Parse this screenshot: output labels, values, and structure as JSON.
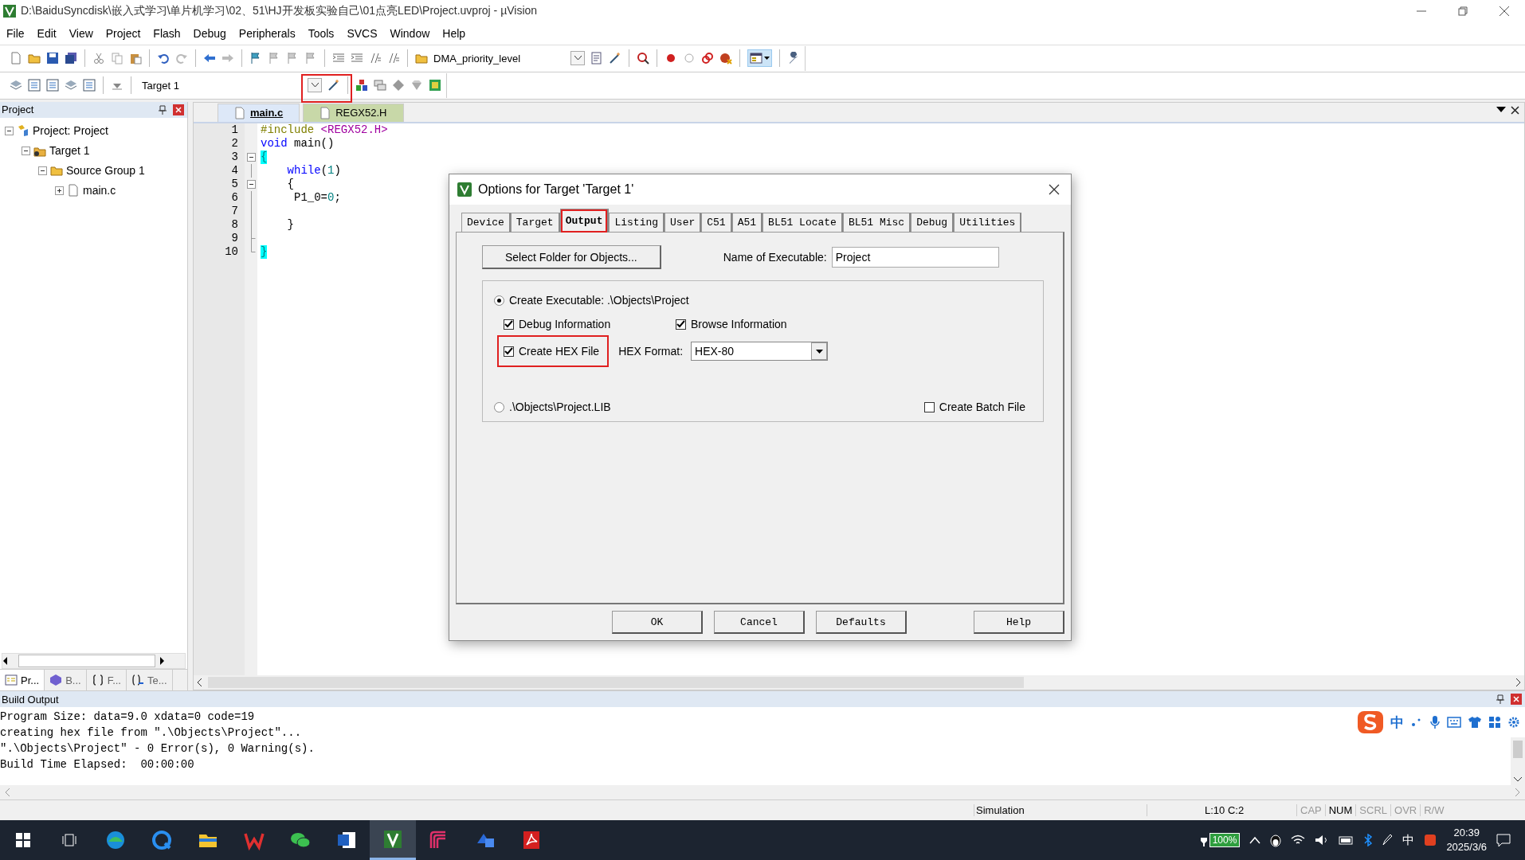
{
  "window": {
    "title": "D:\\BaiduSyncdisk\\嵌入式学习\\单片机学习\\02、51\\HJ开发板实验自己\\01点亮LED\\Project.uvproj - µVision"
  },
  "menu": [
    "File",
    "Edit",
    "View",
    "Project",
    "Flash",
    "Debug",
    "Peripherals",
    "Tools",
    "SVCS",
    "Window",
    "Help"
  ],
  "toolbar": {
    "function_combo": "DMA_priority_level",
    "target_combo": "Target 1",
    "options_button_highlighted": true
  },
  "project_panel": {
    "title": "Project",
    "tree": [
      {
        "label": "Project: Project",
        "kind": "project",
        "expanded": true,
        "children": [
          {
            "label": "Target 1",
            "kind": "target",
            "expanded": true,
            "children": [
              {
                "label": "Source Group 1",
                "kind": "group",
                "expanded": true,
                "children": [
                  {
                    "label": "main.c",
                    "kind": "file",
                    "expanded": false
                  }
                ]
              }
            ]
          }
        ]
      }
    ],
    "tabs": [
      {
        "label": "Pr...",
        "selected": true
      },
      {
        "label": "B...",
        "selected": false
      },
      {
        "label": "F...",
        "selected": false
      },
      {
        "label": "Te...",
        "selected": false
      }
    ]
  },
  "editor": {
    "tabs": [
      {
        "label": "main.c",
        "selected": true
      },
      {
        "label": "REGX52.H",
        "selected": false
      }
    ],
    "lines": [
      {
        "number": "1",
        "fold_box": false,
        "tokens": [
          {
            "kind": "directive",
            "text": "#include"
          },
          {
            "kind": "header",
            "text": " <REGX52.H>"
          }
        ]
      },
      {
        "number": "2",
        "fold_box": false,
        "tokens": [
          {
            "kind": "keyword",
            "text": "void"
          },
          {
            "kind": "plain",
            "text": " main()"
          }
        ]
      },
      {
        "number": "3",
        "fold_box": true,
        "tokens": [
          {
            "kind": "brace-match",
            "text": "{"
          }
        ]
      },
      {
        "number": "4",
        "fold_box": false,
        "tokens": [
          {
            "kind": "keyword",
            "text": "    while"
          },
          {
            "kind": "plain",
            "text": "("
          },
          {
            "kind": "number",
            "text": "1"
          },
          {
            "kind": "plain",
            "text": ")"
          }
        ]
      },
      {
        "number": "5",
        "fold_box": true,
        "tokens": [
          {
            "kind": "plain",
            "text": "    {"
          }
        ]
      },
      {
        "number": "6",
        "fold_box": false,
        "tokens": [
          {
            "kind": "plain",
            "text": "     P1_0="
          },
          {
            "kind": "number",
            "text": "0"
          },
          {
            "kind": "plain",
            "text": ";"
          }
        ]
      },
      {
        "number": "7",
        "fold_box": false
      },
      {
        "number": "8",
        "fold_box": false,
        "tokens": [
          {
            "kind": "plain",
            "text": "    }"
          }
        ]
      },
      {
        "number": "9",
        "fold_box": false
      },
      {
        "number": "10",
        "fold_box": false,
        "tokens": [
          {
            "kind": "brace-match",
            "text": "}"
          }
        ]
      }
    ]
  },
  "dialog": {
    "title": "Options for Target 'Target 1'",
    "tabs": [
      {
        "label": "Device",
        "selected": false,
        "highlighted": false
      },
      {
        "label": "Target",
        "selected": false,
        "highlighted": false
      },
      {
        "label": "Output",
        "selected": true,
        "highlighted": true
      },
      {
        "label": "Listing",
        "selected": false,
        "highlighted": false
      },
      {
        "label": "User",
        "selected": false,
        "highlighted": false
      },
      {
        "label": "C51",
        "selected": false,
        "highlighted": false
      },
      {
        "label": "A51",
        "selected": false,
        "highlighted": false
      },
      {
        "label": "BL51 Locate",
        "selected": false,
        "highlighted": false
      },
      {
        "label": "BL51 Misc",
        "selected": false,
        "highlighted": false
      },
      {
        "label": "Debug",
        "selected": false,
        "highlighted": false
      },
      {
        "label": "Utilities",
        "selected": false,
        "highlighted": false
      }
    ],
    "select_folder_button": "Select Folder for Objects...",
    "name_label": "Name of Executable:",
    "name_value": "Project",
    "create_executable": {
      "label": "Create Executable:  .\\Objects\\Project",
      "selected": true
    },
    "debug_information": {
      "label": "Debug Information",
      "checked": true
    },
    "browse_information": {
      "label": "Browse Information",
      "checked": true
    },
    "create_hex_file": {
      "label": "Create HEX File",
      "checked": true,
      "highlighted": true
    },
    "hex_format": {
      "label": "HEX Format:",
      "value": "HEX-80"
    },
    "create_library": {
      "label": ".\\Objects\\Project.LIB",
      "selected": false
    },
    "create_batch_file": {
      "label": "Create Batch File",
      "checked": false
    },
    "buttons": [
      "OK",
      "Cancel",
      "Defaults",
      "Help"
    ]
  },
  "build_output": {
    "title": "Build Output",
    "lines": [
      "Program Size: data=9.0 xdata=0 code=19",
      "creating hex file from \".\\Objects\\Project\"...",
      "\".\\Objects\\Project\" - 0 Error(s), 0 Warning(s).",
      "Build Time Elapsed:  00:00:00"
    ],
    "ime_mode": "中"
  },
  "status_bar": {
    "mode": "Simulation",
    "position": "L:10 C:2",
    "indicators": [
      {
        "label": "CAP",
        "on": false
      },
      {
        "label": "NUM",
        "on": true
      },
      {
        "label": "SCRL",
        "on": false
      },
      {
        "label": "OVR",
        "on": false
      },
      {
        "label": "R/W",
        "on": false
      }
    ]
  },
  "taskbar": {
    "apps": [
      {
        "selected": false
      },
      {
        "selected": false
      },
      {
        "selected": false
      },
      {
        "selected": false
      },
      {
        "selected": false
      },
      {
        "selected": false
      },
      {
        "selected": true
      },
      {
        "selected": false
      },
      {
        "selected": false
      },
      {
        "selected": false
      }
    ],
    "battery": "100%",
    "tray_ime": "中",
    "time": "20:39",
    "date": "2025/3/6"
  }
}
